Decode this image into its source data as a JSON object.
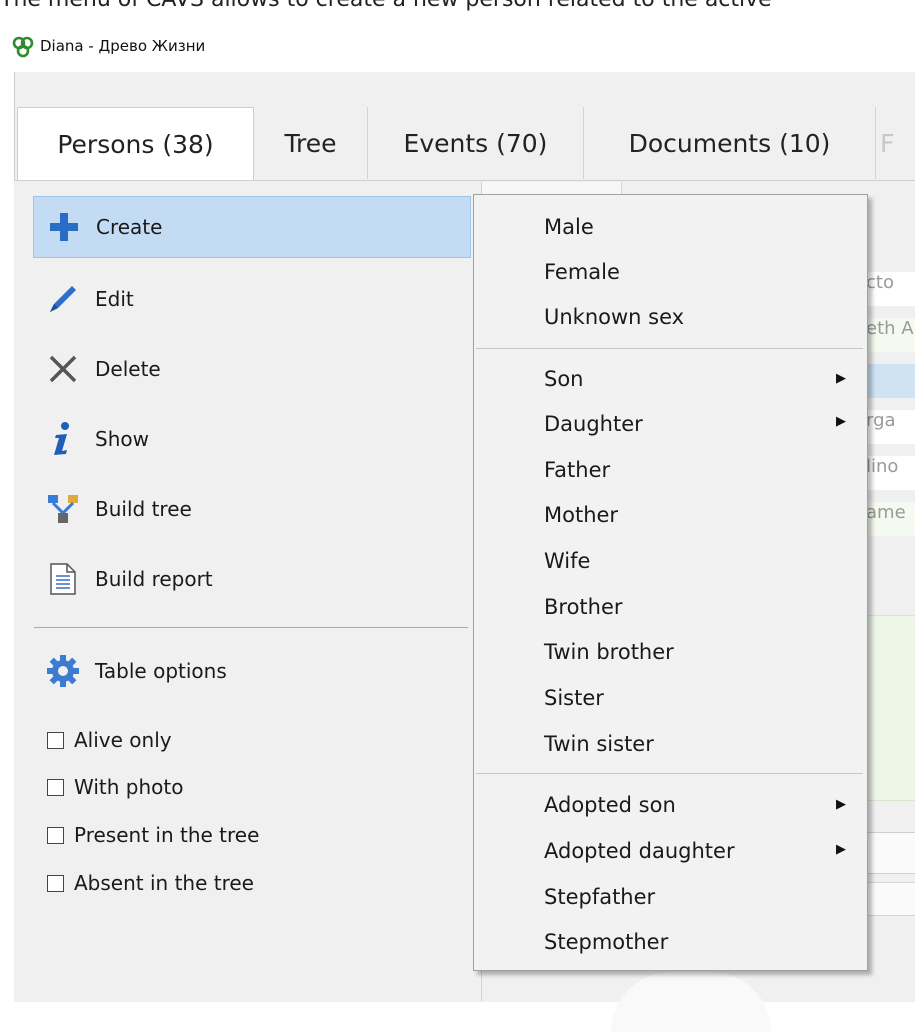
{
  "caption": "The menu of CAVS allows to create a new person related to the active",
  "window": {
    "title": "Diana - Древо Жизни"
  },
  "tabs": [
    {
      "label": "Persons (38)",
      "active": true
    },
    {
      "label": "Tree"
    },
    {
      "label": "Events (70)"
    },
    {
      "label": "Documents (10)"
    },
    {
      "label": "F"
    }
  ],
  "left_menu": {
    "items": [
      {
        "label": "Create",
        "icon": "plus-icon"
      },
      {
        "label": "Edit",
        "icon": "pencil-icon"
      },
      {
        "label": "Delete",
        "icon": "close-icon"
      },
      {
        "label": "Show",
        "icon": "info-icon"
      },
      {
        "label": "Build tree",
        "icon": "tree-icon"
      },
      {
        "label": "Build report",
        "icon": "document-icon"
      }
    ],
    "table_options": {
      "label": "Table options",
      "icon": "gear-icon"
    },
    "filters": [
      {
        "label": "Alive only",
        "checked": false
      },
      {
        "label": "With photo",
        "checked": false
      },
      {
        "label": "Present in the tree",
        "checked": false
      },
      {
        "label": "Absent in the tree",
        "checked": false
      }
    ]
  },
  "background_cells": [
    "cto",
    "eth A",
    "rga",
    "lino",
    "ame"
  ],
  "create_submenu": {
    "group1": [
      "Male",
      "Female",
      "Unknown sex"
    ],
    "group2": [
      {
        "label": "Son",
        "submenu": true
      },
      {
        "label": "Daughter",
        "submenu": true
      },
      {
        "label": "Father"
      },
      {
        "label": "Mother"
      },
      {
        "label": "Wife"
      },
      {
        "label": "Brother"
      },
      {
        "label": "Twin brother"
      },
      {
        "label": "Sister"
      },
      {
        "label": "Twin sister"
      }
    ],
    "group3": [
      {
        "label": "Adopted son",
        "submenu": true
      },
      {
        "label": "Adopted daughter",
        "submenu": true
      },
      {
        "label": "Stepfather"
      },
      {
        "label": "Stepmother"
      }
    ]
  },
  "colors": {
    "selected_bg": "#c4dcf3",
    "plus_blue": "#2b6cc4",
    "gear_blue": "#3d7bd1"
  }
}
